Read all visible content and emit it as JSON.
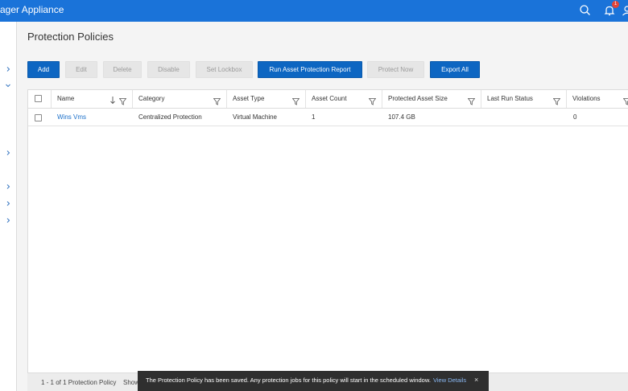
{
  "header": {
    "app_title": "ager Appliance",
    "notification_count": "1",
    "icons": [
      "search-icon",
      "bell-icon",
      "user-icon"
    ],
    "color": "#1a73d9"
  },
  "nav": {
    "chevrons": [
      "chevron-right",
      "chevron-down",
      "chevron-right",
      "chevron-right",
      "chevron-right",
      "chevron-right"
    ]
  },
  "page": {
    "title": "Protection Policies"
  },
  "toolbar": {
    "add": "Add",
    "edit": "Edit",
    "delete": "Delete",
    "disable": "Disable",
    "set_lockbox": "Set Lockbox",
    "run_report": "Run Asset Protection Report",
    "protect_now": "Protect Now",
    "export_all": "Export All"
  },
  "table": {
    "columns": {
      "name": "Name",
      "category": "Category",
      "asset_type": "Asset Type",
      "asset_count": "Asset Count",
      "protected_size": "Protected Asset Size",
      "last_run": "Last Run Status",
      "violations": "Violations"
    },
    "rows": [
      {
        "name": "Wins Vms",
        "category": "Centralized Protection",
        "asset_type": "Virtual Machine",
        "asset_count": "1",
        "protected_size": "107.4 GB",
        "last_run": "",
        "violations": "0"
      }
    ]
  },
  "footer": {
    "count": "1 - 1 of 1 Protection Policy",
    "show": "Show"
  },
  "toast": {
    "message": "The Protection Policy has been saved. Any protection jobs for this policy will start in the scheduled window.",
    "link": "View Details",
    "close": "×"
  }
}
